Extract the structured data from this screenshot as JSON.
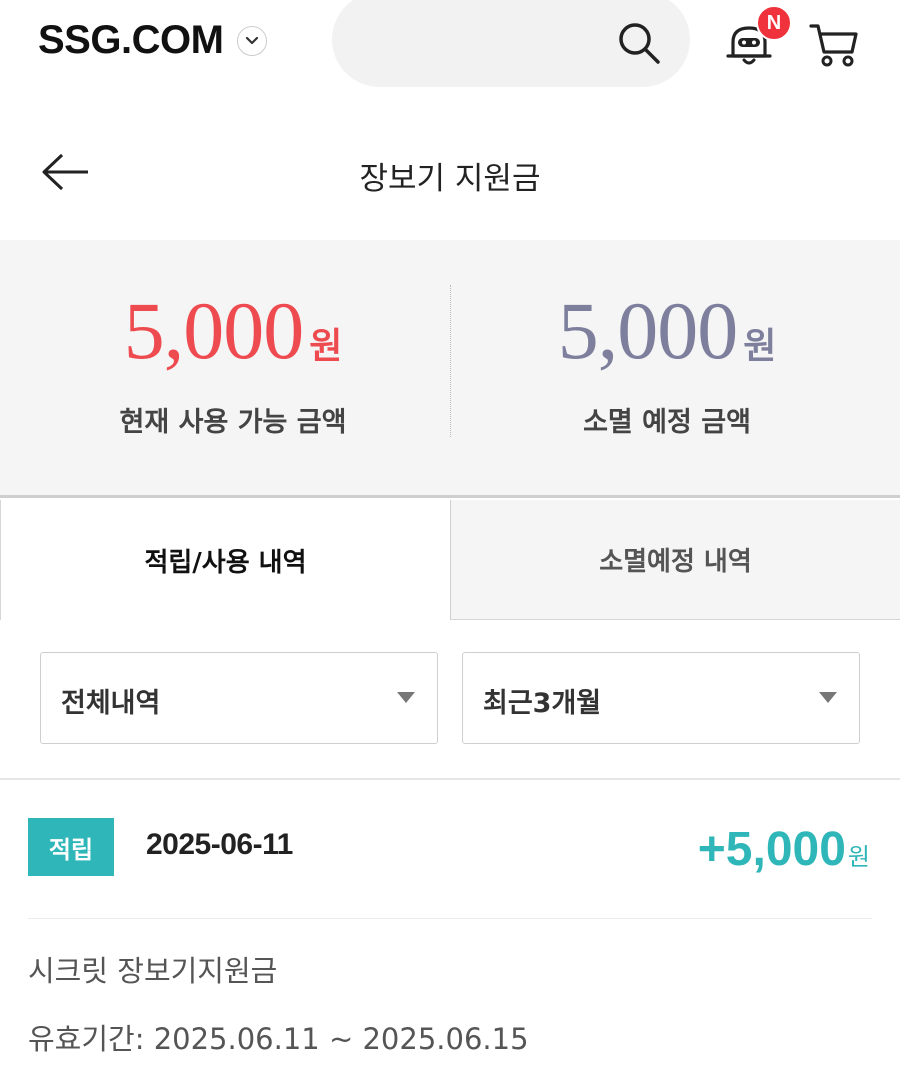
{
  "header": {
    "logo": "SSG.COM",
    "notification_badge": "N",
    "icons": [
      "chevron-down-icon",
      "search-icon",
      "bell-icon",
      "cart-icon"
    ],
    "badge_color": "#f0323d"
  },
  "page": {
    "title": "장보기 지원금",
    "back_icon": "back-arrow-icon"
  },
  "summary": {
    "available": {
      "amount": "5,000",
      "unit": "원",
      "label": "현재 사용 가능 금액",
      "color": "#ee4b50"
    },
    "expiring": {
      "amount": "5,000",
      "unit": "원",
      "label": "소멸 예정 금액",
      "color": "#7d7f9c"
    }
  },
  "tabs": [
    {
      "label": "적립/사용 내역",
      "active": true
    },
    {
      "label": "소멸예정 내역",
      "active": false
    }
  ],
  "filters": {
    "type": {
      "selected": "전체내역"
    },
    "period": {
      "selected": "최근3개월"
    }
  },
  "transactions": [
    {
      "badge": "적립",
      "date": "2025-06-11",
      "amount": "+5,000",
      "unit": "원",
      "description": "시크릿 장보기지원금",
      "validity": "유효기간: 2025.06.11 ~ 2025.06.15",
      "accent_color": "#2fb6b9"
    }
  ]
}
